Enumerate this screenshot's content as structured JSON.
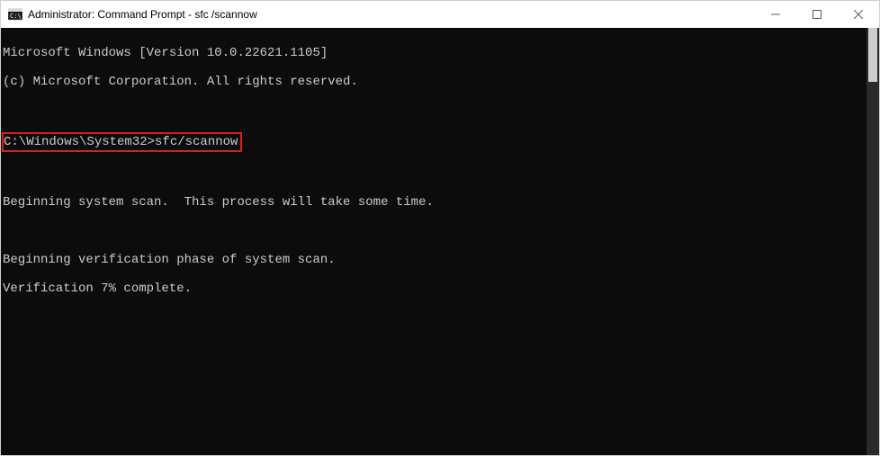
{
  "window": {
    "title": "Administrator: Command Prompt - sfc /scannow"
  },
  "terminal": {
    "lines": {
      "l1": "Microsoft Windows [Version 10.0.22621.1105]",
      "l2": "(c) Microsoft Corporation. All rights reserved.",
      "l3": "",
      "prompt_line": "C:\\Windows\\System32>sfc/scannow",
      "l5": "",
      "l6": "Beginning system scan.  This process will take some time.",
      "l7": "",
      "l8": "Beginning verification phase of system scan.",
      "l9": "Verification 7% complete."
    }
  },
  "annotation": {
    "highlight_color": "#d62020"
  }
}
